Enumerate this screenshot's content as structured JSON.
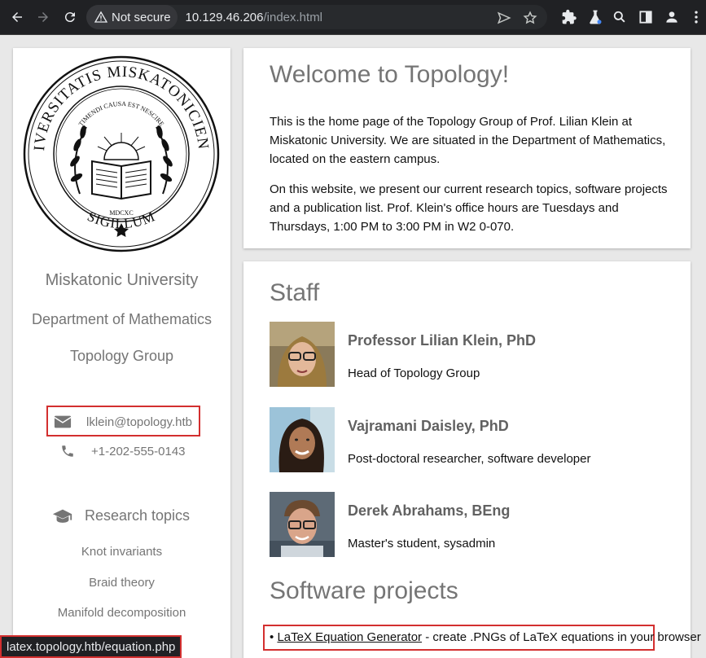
{
  "browser": {
    "security_label": "Not secure",
    "url_host": "10.129.46.206",
    "url_path": "/index.html",
    "status_url": "latex.topology.htb/equation.php"
  },
  "seal": {
    "motto_outer": "UNIVERSITATIS MISKATONICIENSIS",
    "motto_outer_left": "SIGILLUM",
    "motto_inner": "TIMENDI CAUSA EST NESCIRE",
    "year": "MDCXC"
  },
  "sidebar": {
    "university": "Miskatonic University",
    "department": "Department of Mathematics",
    "group": "Topology Group",
    "email": "lklein@topology.htb",
    "phone": "+1-202-555-0143",
    "research_heading": "Research topics",
    "topics": [
      "Knot invariants",
      "Braid theory",
      "Manifold decomposition"
    ]
  },
  "welcome": {
    "title": "Welcome to Topology!",
    "para1": "This is the home page of the Topology Group of Prof. Lilian Klein at Miskatonic University. We are situated in the Department of Mathematics, located on the eastern campus.",
    "para2": "On this website, we present our current research topics, software projects and a publication list. Prof. Klein's office hours are Tuesdays and Thursdays, 1:00 PM to 3:00 PM in W2 0-070."
  },
  "staff": {
    "title": "Staff",
    "members": [
      {
        "name": "Professor Lilian Klein, PhD",
        "role": "Head of Topology Group"
      },
      {
        "name": "Vajramani Daisley, PhD",
        "role": "Post-doctoral researcher, software developer"
      },
      {
        "name": "Derek Abrahams, BEng",
        "role": "Master's student, sysadmin"
      }
    ]
  },
  "software": {
    "title": "Software projects",
    "bullet": "•",
    "project_link": "LaTeX Equation Generator",
    "project_desc": " - create .PNGs of LaTeX equations in your browser"
  },
  "colors": {
    "highlight": "#d32f2f",
    "chrome": "#202124",
    "muted_text": "#757575"
  }
}
